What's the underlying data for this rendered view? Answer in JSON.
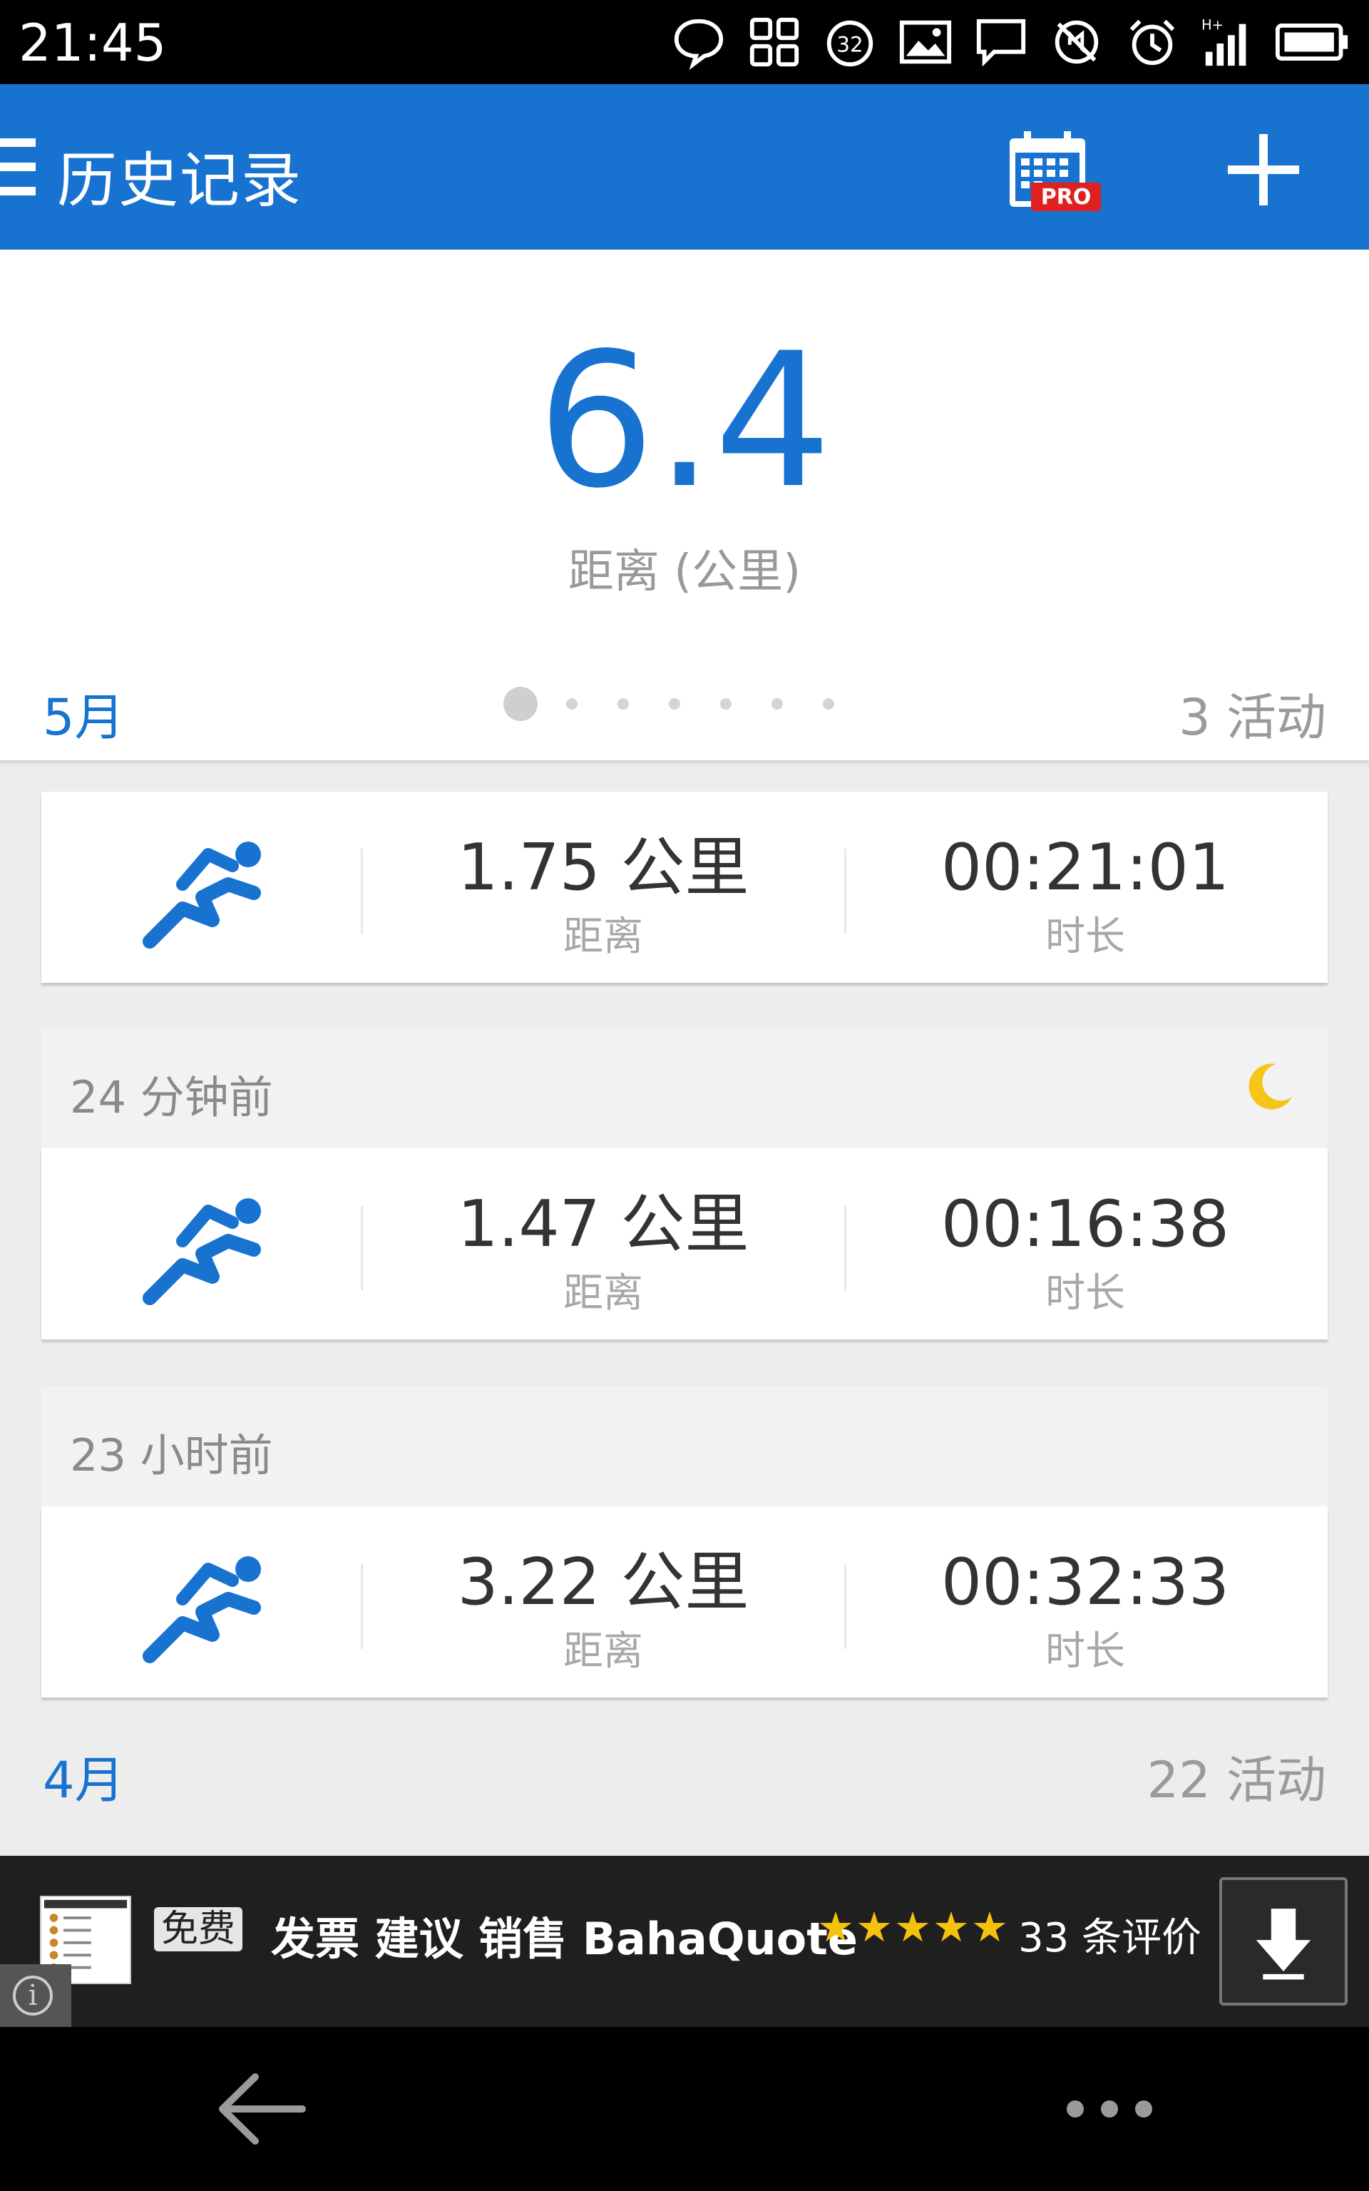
{
  "status_bar": {
    "time": "21:45",
    "icons": [
      "chat-bubble-icon",
      "qr-grid-icon",
      "badge-32-icon",
      "image-icon",
      "message-icon",
      "no-sound-icon",
      "alarm-icon",
      "signal-hplus-icon",
      "battery-icon"
    ],
    "badge_number": "32",
    "network_type": "H+"
  },
  "app_bar": {
    "title": "历史记录",
    "calendar_badge": "PRO",
    "accent_color": "#1873d0"
  },
  "summary": {
    "total_distance": "6.4",
    "distance_label": "距离 (公里)"
  },
  "month_may": {
    "label": "5月",
    "activity_count": "3 活动",
    "page_dots": 7,
    "active_dot": 0
  },
  "activities": [
    {
      "time_ago": "",
      "distance": "1.75 公里",
      "distance_label": "距离",
      "duration": "00:21:01",
      "duration_label": "时长",
      "night": false
    },
    {
      "time_ago": "24 分钟前",
      "distance": "1.47 公里",
      "distance_label": "距离",
      "duration": "00:16:38",
      "duration_label": "时长",
      "night": true
    },
    {
      "time_ago": "23 小时前",
      "distance": "3.22 公里",
      "distance_label": "距离",
      "duration": "00:32:33",
      "duration_label": "时长",
      "night": false
    }
  ],
  "month_april": {
    "label": "4月",
    "activity_count": "22 活动"
  },
  "ad": {
    "free_tag": "免费",
    "text": "发票 建议 销售 BahaQuote",
    "stars": "★★★★★",
    "reviews": "33 条评价"
  }
}
